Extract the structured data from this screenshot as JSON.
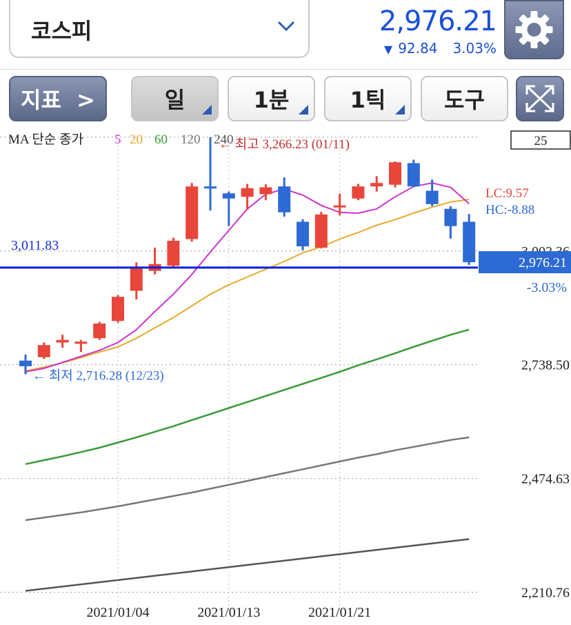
{
  "header": {
    "index_name": "코스피",
    "price": "2,976.21",
    "change": "92.84",
    "change_pct": "3.03%",
    "accent": "#1a4fd6"
  },
  "toolbar": {
    "indicator_label": "지표  >",
    "day_label": "일",
    "minute_label": "1분",
    "tick_label": "1틱",
    "tools_label": "도구"
  },
  "icons": {
    "dropdown": "chevron-down-icon",
    "settings": "gear-icon",
    "expand": "expand-icon"
  },
  "chart_data": {
    "type": "candlestick",
    "ma_legend": {
      "label": "MA 단순 종가",
      "periods": [
        {
          "period": "5",
          "color": "#cc33cc"
        },
        {
          "period": "20",
          "color": "#e8a92a"
        },
        {
          "period": "60",
          "color": "#3a9a3a"
        },
        {
          "period": "120",
          "color": "#777777"
        },
        {
          "period": "240",
          "color": "#555555"
        }
      ]
    },
    "visible_count": "25",
    "ylim": [
      2170,
      3290
    ],
    "y_ticks": [
      {
        "value": 3266.23,
        "label": "3,266.23"
      },
      {
        "value": 3002.36,
        "label": "3,002.36"
      },
      {
        "value": 2738.5,
        "label": "2,738.50"
      },
      {
        "value": 2474.63,
        "label": "2,474.63"
      },
      {
        "value": 2210.76,
        "label": "2,210.76"
      }
    ],
    "x_labels": [
      {
        "index": 5,
        "label": "2021/01/04"
      },
      {
        "index": 11,
        "label": "2021/01/13"
      },
      {
        "index": 17,
        "label": "2021/01/21"
      }
    ],
    "candles": [
      {
        "o": 2748,
        "h": 2762,
        "l": 2716.28,
        "c": 2735
      },
      {
        "o": 2756,
        "h": 2790,
        "l": 2752,
        "c": 2784
      },
      {
        "o": 2790,
        "h": 2808,
        "l": 2778,
        "c": 2796
      },
      {
        "o": 2787,
        "h": 2796,
        "l": 2768,
        "c": 2792
      },
      {
        "o": 2800,
        "h": 2838,
        "l": 2796,
        "c": 2834
      },
      {
        "o": 2840,
        "h": 2900,
        "l": 2836,
        "c": 2896
      },
      {
        "o": 2910,
        "h": 2976,
        "l": 2890,
        "c": 2966
      },
      {
        "o": 2956,
        "h": 3010,
        "l": 2948,
        "c": 2972
      },
      {
        "o": 2968,
        "h": 3033,
        "l": 2962,
        "c": 3026
      },
      {
        "o": 3030,
        "h": 3160,
        "l": 3024,
        "c": 3152
      },
      {
        "o": 3152,
        "h": 3266.23,
        "l": 3096,
        "c": 3149
      },
      {
        "o": 3136,
        "h": 3140,
        "l": 3060,
        "c": 3124
      },
      {
        "o": 3128,
        "h": 3158,
        "l": 3098,
        "c": 3148
      },
      {
        "o": 3134,
        "h": 3157,
        "l": 3120,
        "c": 3150
      },
      {
        "o": 3152,
        "h": 3173,
        "l": 3082,
        "c": 3092
      },
      {
        "o": 3070,
        "h": 3076,
        "l": 3004,
        "c": 3013
      },
      {
        "o": 3010,
        "h": 3093,
        "l": 3008,
        "c": 3087
      },
      {
        "o": 3105,
        "h": 3135,
        "l": 3085,
        "c": 3108
      },
      {
        "o": 3124,
        "h": 3158,
        "l": 3120,
        "c": 3152
      },
      {
        "o": 3152,
        "h": 3176,
        "l": 3140,
        "c": 3160
      },
      {
        "o": 3156,
        "h": 3210,
        "l": 3150,
        "c": 3208
      },
      {
        "o": 3206,
        "h": 3214,
        "l": 3150,
        "c": 3152
      },
      {
        "o": 3142,
        "h": 3168,
        "l": 3106,
        "c": 3111
      },
      {
        "o": 3100,
        "h": 3106,
        "l": 3031,
        "c": 3060
      },
      {
        "o": 3070,
        "h": 3088,
        "l": 2970,
        "c": 2976.21
      }
    ],
    "ma_lines": {
      "ma5": [
        2722,
        2730,
        2744,
        2758,
        2772,
        2790,
        2820,
        2862,
        2902,
        2948,
        3000,
        3050,
        3100,
        3134,
        3146,
        3132,
        3108,
        3092,
        3090,
        3100,
        3128,
        3152,
        3160,
        3150,
        3112
      ],
      "ma20": [
        2724,
        2733,
        2743,
        2755,
        2768,
        2780,
        2800,
        2824,
        2848,
        2875,
        2902,
        2924,
        2942,
        2960,
        2978,
        2998,
        3012,
        3030,
        3045,
        3062,
        3075,
        3090,
        3104,
        3116,
        3122
      ],
      "ma60": [
        2508,
        2517,
        2526,
        2536,
        2546,
        2558,
        2570,
        2583,
        2596,
        2610,
        2624,
        2638,
        2652,
        2666,
        2680,
        2694,
        2708,
        2722,
        2737,
        2751,
        2765,
        2780,
        2794,
        2808,
        2820
      ],
      "ma120": [
        2378,
        2384,
        2390,
        2396,
        2403,
        2410,
        2418,
        2426,
        2434,
        2442,
        2451,
        2460,
        2469,
        2478,
        2487,
        2496,
        2505,
        2514,
        2523,
        2531,
        2540,
        2548,
        2556,
        2564,
        2570
      ],
      "ma240": [
        2214,
        2219,
        2224,
        2229,
        2234,
        2239,
        2244,
        2249,
        2254,
        2259,
        2264,
        2269,
        2274,
        2279,
        2284,
        2289,
        2294,
        2299,
        2304,
        2309,
        2314,
        2319,
        2324,
        2329,
        2334
      ]
    },
    "colors": {
      "up": "#e8463a",
      "down": "#2d6ad4",
      "ma5": "#cc33cc",
      "ma20": "#e8a92a",
      "ma60": "#3a9a3a",
      "ma120": "#777777",
      "ma240": "#555555"
    },
    "max_annotation": {
      "index": 10,
      "value": 3266.23,
      "text": "← 최고 3,266.23 (01/11)"
    },
    "min_annotation": {
      "index": 0,
      "value": 2716.28,
      "text": "← 최저 2,716.28 (12/23)"
    },
    "crosshair": {
      "value": 3011.83,
      "label": "3,011.83"
    },
    "current": {
      "value": 2976.21,
      "label": "2,976.21",
      "pct": "-3.03%"
    },
    "lc_label": "LC:9.57",
    "hc_label": "HC:-8.88"
  }
}
